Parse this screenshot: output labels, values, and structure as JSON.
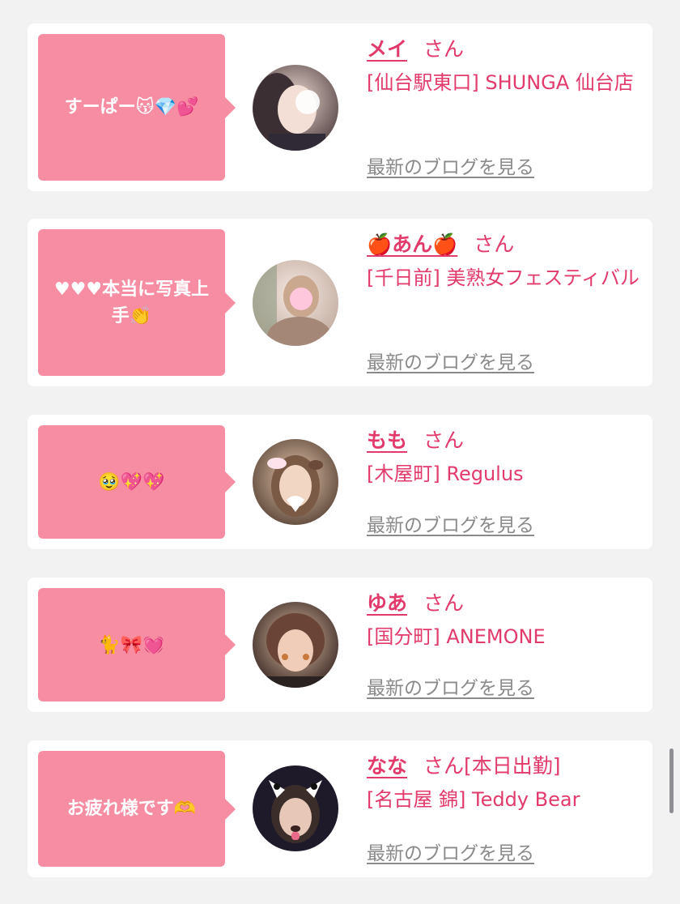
{
  "blog_link_label": "最新のブログを見る",
  "cards": [
    {
      "comment": "すーぱー😽💎💕",
      "name": "メイ",
      "suffix": "さん",
      "shop": "[仙台駅東口] SHUNGA 仙台店"
    },
    {
      "comment": "♥♥♥本当に写真上手👏",
      "name": "🍎あん🍎",
      "suffix": "さん",
      "shop": "[千日前] 美熟女フェスティバル"
    },
    {
      "comment": "🥹💖💖",
      "name": "もも",
      "suffix": "さん",
      "shop": "[木屋町] Regulus"
    },
    {
      "comment": "🐈🎀💓",
      "name": "ゆあ",
      "suffix": "さん",
      "shop": "[国分町] ANEMONE"
    },
    {
      "comment": "お疲れ様です🫶",
      "name": "なな",
      "suffix": "さん[本日出勤]",
      "shop": "[名古屋 錦] Teddy Bear"
    }
  ],
  "colors": {
    "accent": "#e13a6b",
    "bubble": "#f78da2",
    "link_gray": "#8a8a8a",
    "background": "#f2f2f3"
  }
}
